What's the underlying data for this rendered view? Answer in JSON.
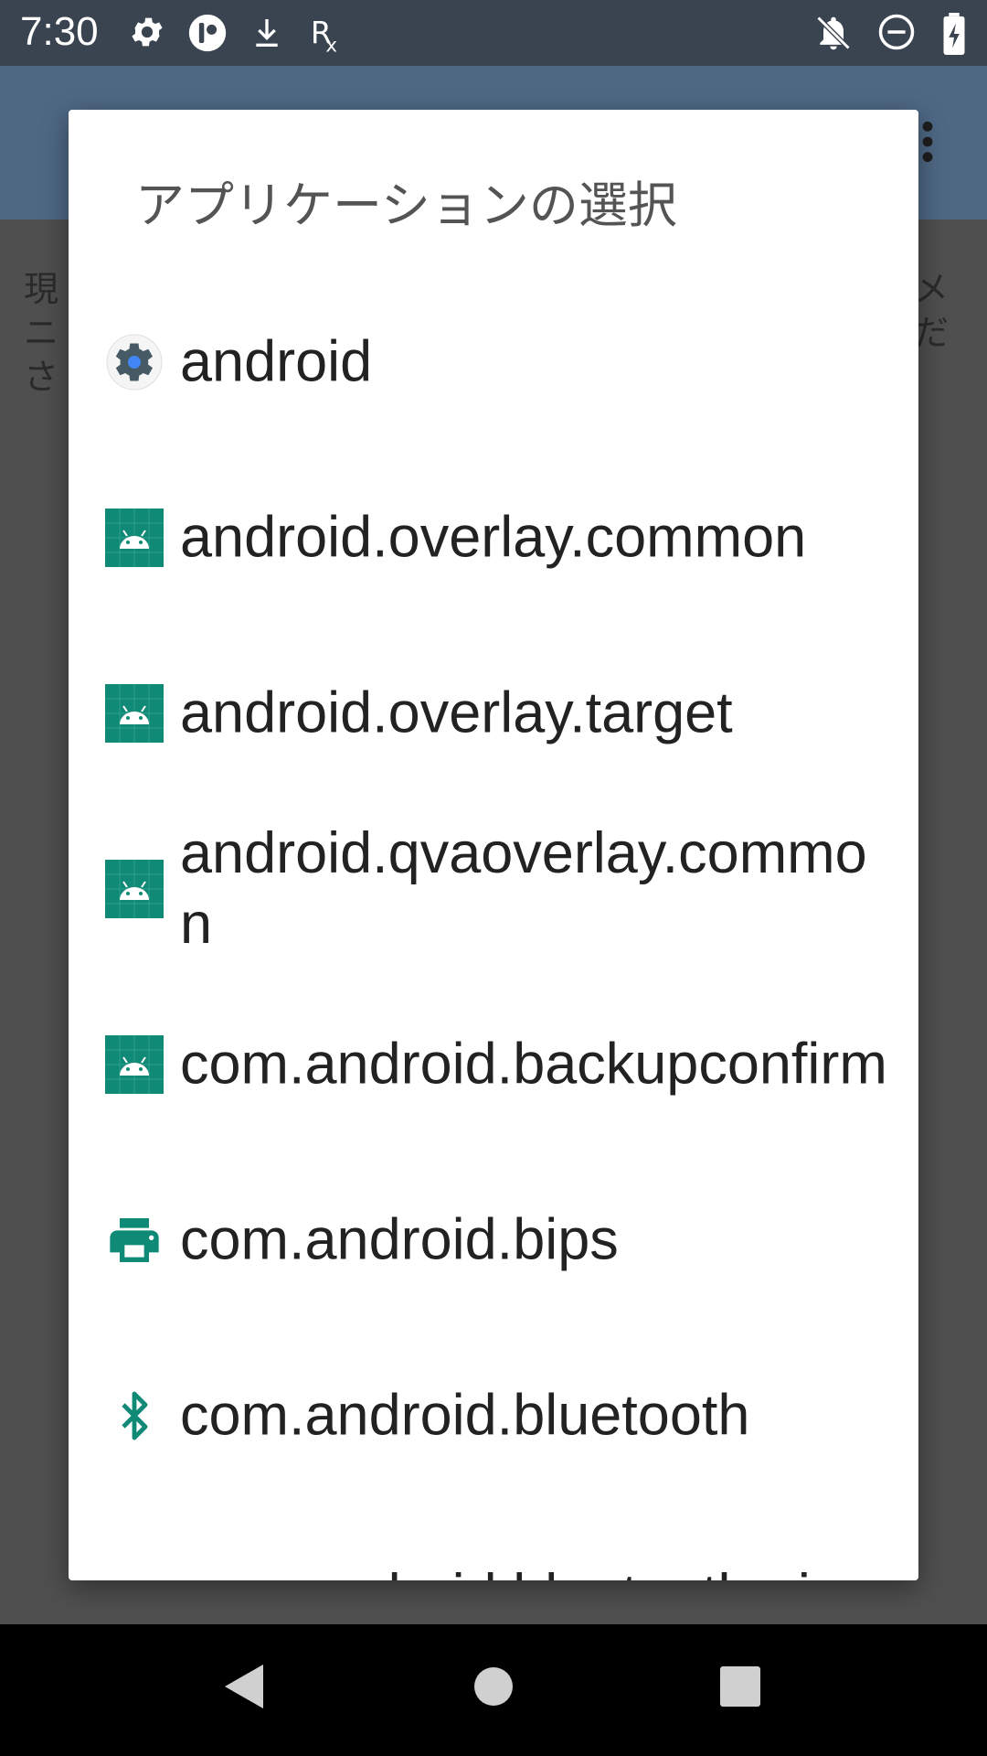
{
  "status_bar": {
    "time": "7:30",
    "left_icons": [
      "gear-icon",
      "app-circle-icon",
      "download-icon",
      "rx-icon"
    ],
    "right_icons": [
      "notifications-off-icon",
      "do-not-disturb-icon",
      "battery-charging-icon"
    ]
  },
  "background_app": {
    "text_left": "現\nニ\nさ",
    "text_right": "メ\nだ"
  },
  "dialog": {
    "title": "アプリケーションの選択",
    "items": [
      {
        "label": "android",
        "icon": "android-system-gear-icon"
      },
      {
        "label": "android.overlay.common",
        "icon": "android-robot-icon"
      },
      {
        "label": "android.overlay.target",
        "icon": "android-robot-icon"
      },
      {
        "label": "android.qvaoverlay.common",
        "icon": "android-robot-icon"
      },
      {
        "label": "com.android.backupconfirm",
        "icon": "android-robot-icon"
      },
      {
        "label": "com.android.bips",
        "icon": "printer-icon"
      },
      {
        "label": "com.android.bluetooth",
        "icon": "bluetooth-icon"
      },
      {
        "label": "com.android.bluetoothmi",
        "icon": "android-robot-icon"
      }
    ]
  },
  "colors": {
    "android_icon_green": "#0f8a76",
    "dialog_bg": "#ffffff",
    "toolbar": "#4e6884",
    "status_bar": "#3a4450"
  },
  "nav_bar": {
    "buttons": [
      "back-icon",
      "home-icon",
      "recents-icon"
    ]
  }
}
